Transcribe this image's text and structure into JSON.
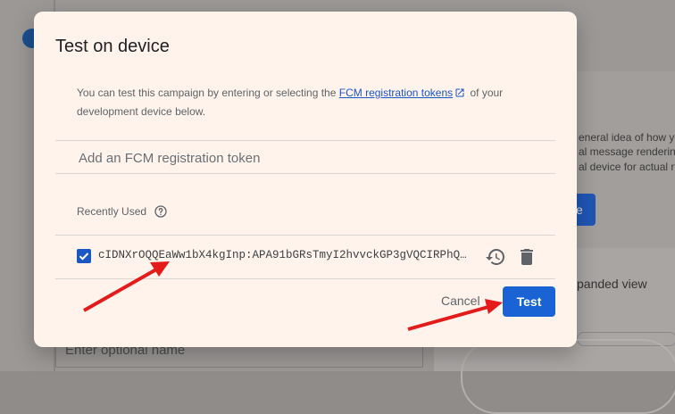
{
  "background": {
    "text_lines": [
      "eneral idea of how yo",
      "al message rendering",
      "al device for actual re"
    ],
    "button_label": "Te",
    "expanded_view": "panded view",
    "optional_name_placeholder": "Enter optional name"
  },
  "dialog": {
    "title": "Test on device",
    "description_before": "You can test this campaign by entering or selecting the ",
    "link_label": "FCM registration tokens",
    "description_after": " of your development device below.",
    "token_placeholder": "Add an FCM registration token",
    "recently_used_label": "Recently Used",
    "recent_tokens": [
      {
        "checked": true,
        "token": "cIDNXrOQQEaWw1bX4kgInp:APA91bGRsTmyI2hvvckGP3gVQCIRPhQ…"
      }
    ],
    "cancel_label": "Cancel",
    "test_label": "Test"
  },
  "colors": {
    "accent": "#1a63d4",
    "annotation_arrow": "#e31b1b",
    "dialog_bg": "#fff3ec"
  }
}
